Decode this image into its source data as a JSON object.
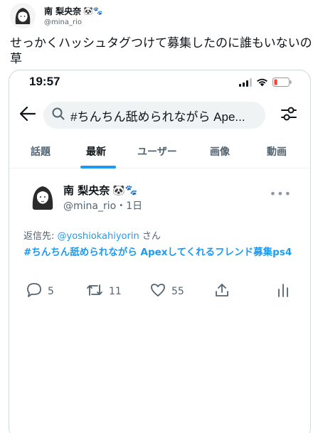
{
  "outer": {
    "name": "南 梨央奈",
    "name_emoji": "🐼🐾",
    "handle": "@mina_rio",
    "text": "せっかくハッシュタグつけて募集したのに誰もいないの草"
  },
  "status_bar": {
    "time": "19:57"
  },
  "search": {
    "query": "#ちんちん舐められながら Ape..."
  },
  "tabs": [
    {
      "label": "話題"
    },
    {
      "label": "最新"
    },
    {
      "label": "ユーザー"
    },
    {
      "label": "画像"
    },
    {
      "label": "動画"
    }
  ],
  "inner_tweet": {
    "name": "南 梨央奈",
    "name_emoji": "🐼🐾",
    "handle": "@mina_rio",
    "time": "1日",
    "reply_prefix": "返信先: ",
    "reply_mention": "@yoshiokahiyorin",
    "reply_suffix": " さん",
    "hashtag_text": "#ちんちん舐められながら Apexしてくれるフレンド募集ps4"
  },
  "actions": {
    "replies": "5",
    "retweets": "11",
    "likes": "55"
  },
  "colors": {
    "accent": "#1d9bf0",
    "secondary_text": "#536471",
    "search_bg": "#eff3f4"
  }
}
